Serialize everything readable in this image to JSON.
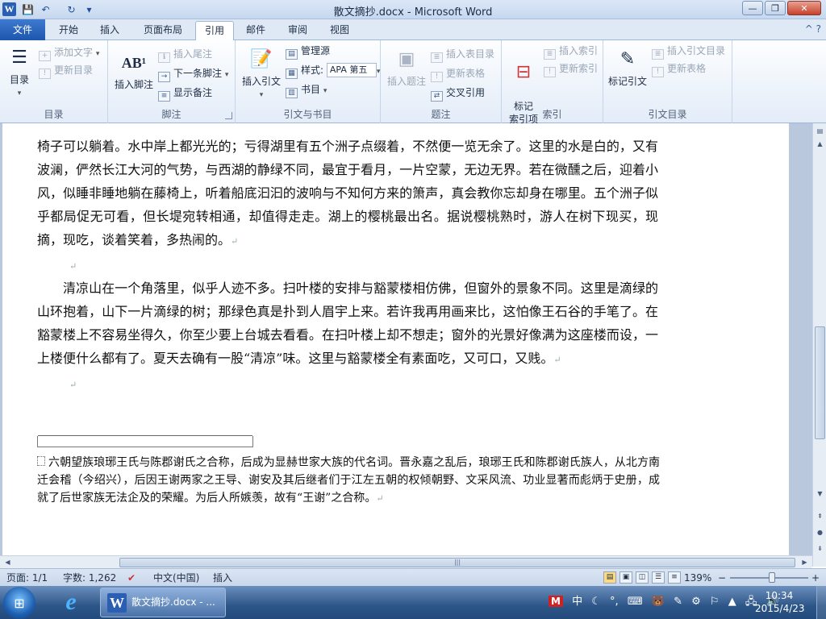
{
  "window": {
    "title": "散文摘抄.docx - Microsoft Word",
    "app_icon_label": "W",
    "minimize": "—",
    "restore": "❐",
    "close": "✕"
  },
  "quick_access": {
    "save": "💾",
    "undo": "↶",
    "redo": "↻",
    "customize": "▾"
  },
  "tabs": {
    "file": "文件",
    "items": [
      "开始",
      "插入",
      "页面布局",
      "引用",
      "邮件",
      "审阅",
      "视图"
    ],
    "active": "引用",
    "help": "^ ?"
  },
  "ribbon": {
    "toc": {
      "label": "目录",
      "add_text": "添加文字",
      "update_toc": "更新目录",
      "group": "目录"
    },
    "footnotes": {
      "insert_footnote": "插入脚注",
      "insert_endnote": "插入尾注",
      "next_footnote": "下一条脚注",
      "show_notes": "显示备注",
      "group": "脚注",
      "ab_icon": "AB¹"
    },
    "citations": {
      "insert_citation": "插入引文",
      "manage_sources": "管理源",
      "style_label": "样式:",
      "style_value": "APA 第五",
      "bibliography": "书目",
      "group": "引文与书目"
    },
    "captions": {
      "insert_caption": "插入题注",
      "insert_table_of_figures": "插入表目录",
      "update_table": "更新表格",
      "cross_reference": "交叉引用",
      "group": "题注"
    },
    "index": {
      "mark_entry": "标记\n索引项",
      "insert_index": "插入索引",
      "update_index": "更新索引",
      "group": "索引"
    },
    "toa": {
      "mark_citation": "标记引文",
      "insert_toa": "插入引文目录",
      "update_table": "更新表格",
      "group": "引文目录"
    }
  },
  "document": {
    "paragraph1": "椅子可以躺着。水中岸上都光光的；亏得湖里有五个洲子点缀着，不然便一览无余了。这里的水是白的，又有波澜，俨然长江大河的气势，与西湖的静绿不同，最宜于看月，一片空蒙，无边无界。若在微醺之后，迎着小风，似睡非睡地躺在藤椅上，听着船底汩汩的波响与不知何方来的箫声，真会教你忘却身在哪里。五个洲子似乎都局促无可看，但长堤宛转相通，却值得走走。湖上的樱桃最出名。据说樱桃熟时，游人在树下现买，现摘，现吃，谈着笑着，多热闹的。",
    "paragraph2": "清凉山在一个角落里，似乎人迹不多。扫叶楼的安排与豁蒙楼相仿佛，但窗外的景象不同。这里是滴绿的山环抱着，山下一片滴绿的树；那绿色真是扑到人眉宇上来。若许我再用画来比，这怕像王石谷的手笔了。在豁蒙楼上不容易坐得久，你至少要上台城去看看。在扫叶楼上却不想走；窗外的光景好像满为这座楼而设，一上楼便什么都有了。夏天去确有一股“清凉”味。这里与豁蒙楼全有素面吃，又可口，又贱。",
    "paragraph_mark": "↵",
    "footnote": "六朝望族琅琊王氏与陈郡谢氏之合称，后成为显赫世家大族的代名词。晋永嘉之乱后，琅琊王氏和陈郡谢氏族人，从北方南迁会稽（今绍兴），后因王谢两家之王导、谢安及其后继者们于江左五朝的权倾朝野、文采风流、功业显著而彪炳于史册，成就了后世家族无法企及的荣耀。为后人所嫉羡，故有“王谢”之合称。"
  },
  "statusbar": {
    "page": "页面: 1/1",
    "words": "字数: 1,262",
    "language": "中文(中国)",
    "mode": "插入",
    "zoom": "139%",
    "zoom_minus": "−",
    "zoom_plus": "+"
  },
  "taskbar": {
    "start": "⊞",
    "ie": "e",
    "word_task": "散文摘抄.docx - ...",
    "ime": "M",
    "ime_mode": "中",
    "tray_icons": [
      "☾",
      "°,",
      "⌨",
      "🐻",
      "✎",
      "⚙",
      "⚐"
    ],
    "time": "10:34",
    "date": "2015/4/23"
  }
}
